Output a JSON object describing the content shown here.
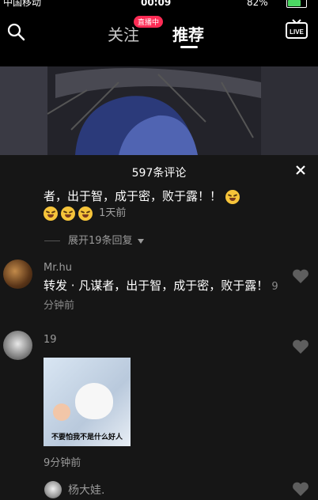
{
  "status": {
    "carrier": "中国移动",
    "time": "00:09",
    "battery": "82%",
    "battery_level": 0.82
  },
  "header": {
    "tabs": [
      {
        "label": "关注"
      },
      {
        "label": "推荐"
      }
    ],
    "live_badge": "直播中",
    "live_label": "LIVE"
  },
  "panel": {
    "title": "597条评论",
    "cont_line1": "者，出于智，成于密，败于露！！",
    "cont_time": "1天前",
    "expand": "展开19条回复",
    "comments": [
      {
        "name": "Mr.hu",
        "text": "转发 · 凡谋者，出于智，成于密，败于露！",
        "time": "9分钟前"
      },
      {
        "name": "19",
        "image_caption": "不要怕我不是什么好人",
        "time": "9分钟前"
      },
      {
        "name": "杨大娃."
      }
    ]
  },
  "colors": {
    "accent": "#fe2c55",
    "panel_bg": "#161616"
  }
}
